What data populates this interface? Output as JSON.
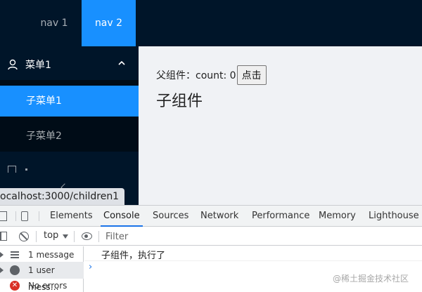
{
  "header": {
    "nav": [
      "nav 1",
      "nav 2"
    ],
    "active_nav": "nav 2"
  },
  "sidebar": {
    "submenu_title": "菜单1",
    "items": [
      {
        "label": "子菜单1",
        "active": true
      },
      {
        "label": "子菜单2",
        "active": false
      }
    ]
  },
  "content": {
    "parent_label": "父组件：count: 0",
    "button_label": "点击",
    "child_title": "子组件"
  },
  "status_url": "ocalhost:3000/children1",
  "devtools": {
    "tabs": [
      "Elements",
      "Console",
      "Sources",
      "Network",
      "Performance",
      "Memory",
      "Lighthouse"
    ],
    "active_tab": "Console",
    "context": "top",
    "filter_placeholder": "Filter",
    "sidebar_rows": [
      "1 message",
      "1 user mess…",
      "No errors"
    ],
    "log_message": "子组件，执行了",
    "prompt": "›"
  },
  "watermark": "@稀土掘金技术社区",
  "colors": {
    "dark_bg": "#001529",
    "accent": "#1890ff",
    "content_bg": "#f0f2f5",
    "devtools_active": "#1a73e8"
  }
}
